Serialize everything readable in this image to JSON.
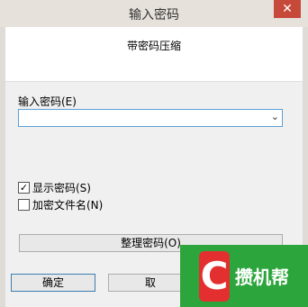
{
  "dialog": {
    "title": "输入密码",
    "close_glyph": "✕",
    "header_text": "带密码压缩",
    "password_label": "输入密码(E)",
    "password_value": "",
    "show_password_label": "显示密码(S)",
    "show_password_checked": true,
    "encrypt_names_label": "加密文件名(N)",
    "encrypt_names_checked": false,
    "organize_button": "整理密码(O)",
    "ok_button": "确定",
    "cancel_button_partial": "取"
  },
  "watermark": {
    "letter": "C",
    "text": "攒机帮"
  }
}
